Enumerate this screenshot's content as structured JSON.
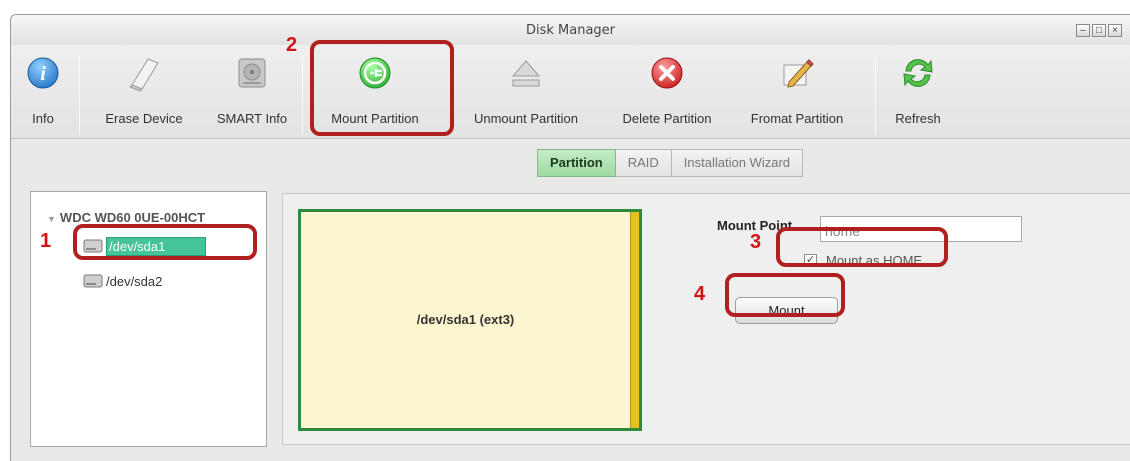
{
  "window": {
    "title": "Disk Manager"
  },
  "window_controls": [
    "minimize",
    "maximize",
    "close"
  ],
  "toolbar": {
    "items": [
      {
        "label": "Info",
        "icon": "info-icon"
      },
      {
        "label": "Erase Device",
        "icon": "eraser-icon"
      },
      {
        "label": "SMART Info",
        "icon": "hard-drive-icon"
      },
      {
        "label": "Mount Partition",
        "icon": "plug-icon"
      },
      {
        "label": "Unmount Partition",
        "icon": "eject-icon"
      },
      {
        "label": "Delete Partition",
        "icon": "delete-x-icon"
      },
      {
        "label": "Fromat Partition",
        "icon": "format-pencil-icon"
      },
      {
        "label": "Refresh",
        "icon": "refresh-icon"
      }
    ]
  },
  "tabs": [
    {
      "label": "Partition",
      "active": true
    },
    {
      "label": "RAID",
      "active": false
    },
    {
      "label": "Installation Wizard",
      "active": false
    }
  ],
  "tree": {
    "device": "WDC WD60 0UE-00HCT",
    "partitions": [
      {
        "label": "/dev/sda1",
        "selected": true
      },
      {
        "label": "/dev/sda2",
        "selected": false
      }
    ]
  },
  "partition_view": {
    "label": "/dev/sda1 (ext3)"
  },
  "mount_form": {
    "mount_point_label": "Mount Point",
    "mount_point_value": "home",
    "mount_as_home_label": "Mount as HOME",
    "mount_as_home_checked": true,
    "mount_button": "Mount"
  },
  "callouts": [
    "1",
    "2",
    "3",
    "4"
  ],
  "colors": {
    "highlight": "#b11f1f",
    "selection": "#45c49a",
    "active_tab": "#9edaa3",
    "partition_fill": "#fbf6cf"
  }
}
